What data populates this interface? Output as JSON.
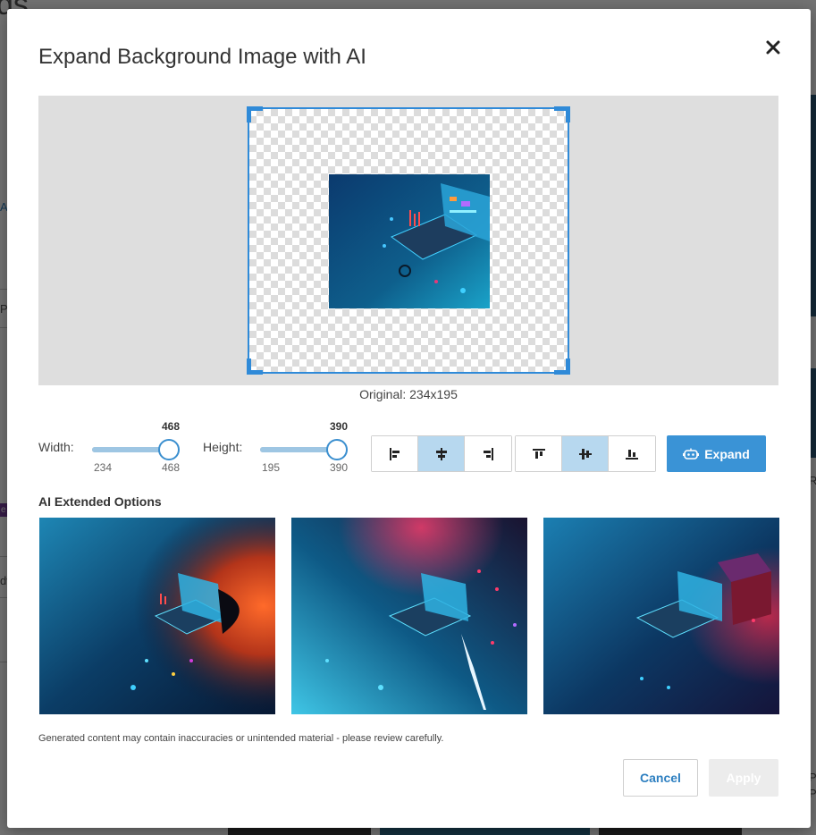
{
  "background": {
    "title_fragment": "ds",
    "left_fragments": [
      "A",
      "Pu",
      "dv"
    ],
    "badge_fragment": "e",
    "right_fragments": [
      "R",
      "P",
      "P"
    ]
  },
  "modal": {
    "title": "Expand Background Image with AI",
    "close_icon": "close-icon"
  },
  "preview": {
    "original_caption": "Original: 234x195"
  },
  "controls": {
    "width": {
      "label": "Width:",
      "current": "468",
      "min": "234",
      "max": "468",
      "value_fraction": 1.0
    },
    "height": {
      "label": "Height:",
      "current": "390",
      "min": "195",
      "max": "390",
      "value_fraction": 1.0
    },
    "horizontal_align": [
      {
        "icon": "align-left-icon",
        "active": false
      },
      {
        "icon": "align-center-horizontal-icon",
        "active": true
      },
      {
        "icon": "align-right-icon",
        "active": false
      }
    ],
    "vertical_align": [
      {
        "icon": "align-top-icon",
        "active": false
      },
      {
        "icon": "align-middle-vertical-icon",
        "active": true
      },
      {
        "icon": "align-bottom-icon",
        "active": false
      }
    ],
    "expand_label": "Expand",
    "expand_icon": "robot-icon"
  },
  "options": {
    "title": "AI Extended Options",
    "items": [
      {
        "name": "option-1"
      },
      {
        "name": "option-2"
      },
      {
        "name": "option-3"
      }
    ]
  },
  "footer": {
    "disclaimer": "Generated content may contain inaccuracies or unintended material - please review carefully.",
    "cancel_label": "Cancel",
    "apply_label": "Apply"
  },
  "colors": {
    "accent": "#3a93d6",
    "active_toggle": "#b7d8ef",
    "slider_fill": "#9ec6e3"
  }
}
